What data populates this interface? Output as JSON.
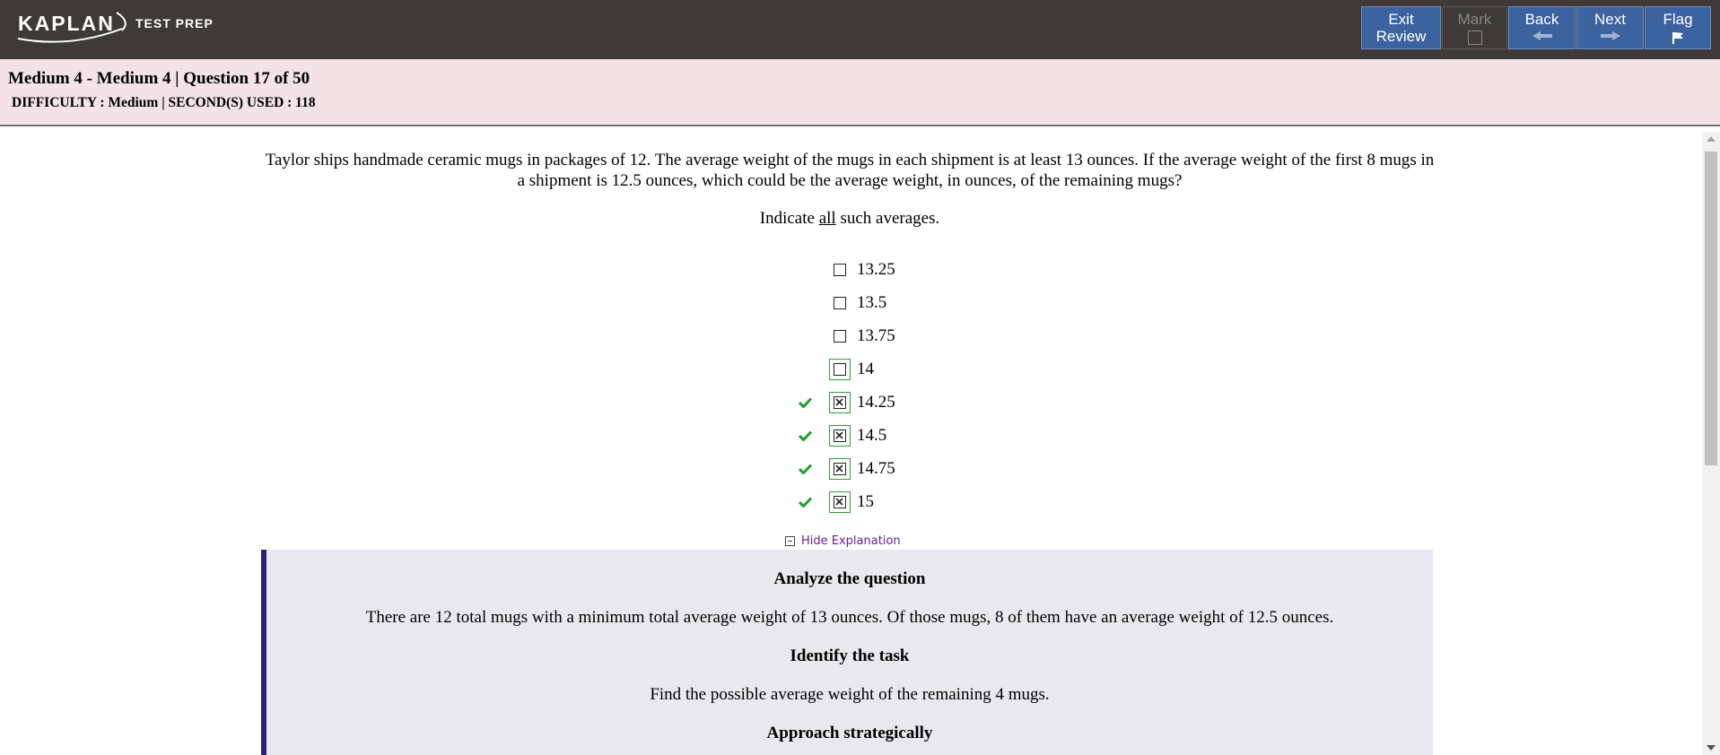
{
  "header": {
    "logo_text": "KAPLAN",
    "logo_tagline": "TEST PREP",
    "nav": {
      "exit_review": [
        "Exit",
        "Review"
      ],
      "mark": "Mark",
      "back": "Back",
      "next": "Next",
      "flag": "Flag"
    }
  },
  "info": {
    "title": "Medium 4 - Medium 4 | Question 17 of 50",
    "meta": "DIFFICULTY : Medium | SECOND(S) USED : 118"
  },
  "question": {
    "stem": "Taylor ships handmade ceramic mugs in packages of 12. The average weight of the mugs in each shipment is at least 13 ounces. If the average weight of the first 8 mugs in a shipment is 12.5 ounces, which could be the average weight, in ounces, of the remaining mugs?",
    "instruction_pre": "Indicate ",
    "instruction_emph": "all",
    "instruction_post": " such averages.",
    "choices": [
      {
        "label": "13.25",
        "checked": false,
        "correct": false,
        "highlight": false
      },
      {
        "label": "13.5",
        "checked": false,
        "correct": false,
        "highlight": false
      },
      {
        "label": "13.75",
        "checked": false,
        "correct": false,
        "highlight": false
      },
      {
        "label": "14",
        "checked": false,
        "correct": false,
        "highlight": true
      },
      {
        "label": "14.25",
        "checked": true,
        "correct": true,
        "highlight": true
      },
      {
        "label": "14.5",
        "checked": true,
        "correct": true,
        "highlight": true
      },
      {
        "label": "14.75",
        "checked": true,
        "correct": true,
        "highlight": true
      },
      {
        "label": "15",
        "checked": true,
        "correct": true,
        "highlight": true
      }
    ]
  },
  "explanation": {
    "toggle_label": "Hide Explanation",
    "h1": "Analyze the question",
    "p1": "There are 12 total mugs with a minimum total average weight of 13 ounces. Of those mugs, 8 of them have an average weight of 12.5 ounces.",
    "h2": "Identify the task",
    "p2": "Find the possible average weight of the remaining 4 mugs.",
    "h3": "Approach strategically"
  },
  "colors": {
    "topbar": "#3f3a37",
    "nav_button": "#3b63a0",
    "infobar": "#f3e2e6",
    "correct_check": "#1aa12b",
    "explanation_bg": "#e9e8f0",
    "explanation_border": "#2a2077",
    "toggle_link": "#6a1b9a"
  }
}
